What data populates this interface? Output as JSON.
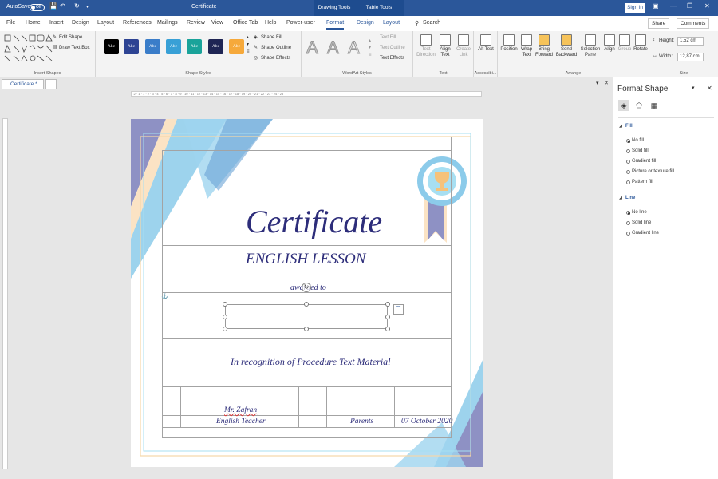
{
  "titlebar": {
    "autosave_label": "AutoSave",
    "autosave_state": "Off",
    "doc_title": "Certificate",
    "context_drawing": "Drawing Tools",
    "context_table": "Table Tools",
    "signin": "Sign in"
  },
  "tabs": [
    "File",
    "Home",
    "Insert",
    "Design",
    "Layout",
    "References",
    "Mailings",
    "Review",
    "View",
    "Office Tab",
    "Help",
    "Power-user",
    "Format",
    "Design",
    "Layout"
  ],
  "search_label": "Search",
  "share_label": "Share",
  "comments_label": "Comments",
  "ribbon": {
    "insert_shapes": {
      "label": "Insert Shapes",
      "edit_shape": "Edit Shape",
      "draw_text_box": "Draw Text Box"
    },
    "shape_styles": {
      "label": "Shape Styles",
      "style_text": "Abc",
      "colors": [
        "#000000",
        "#2d4393",
        "#3a7dc9",
        "#38a0d6",
        "#1aa39a",
        "#1f2554",
        "#f6a93b"
      ],
      "fill": "Shape Fill",
      "outline": "Shape Outline",
      "effects": "Shape Effects"
    },
    "wordart": {
      "label": "WordArt Styles",
      "glyph": "A",
      "text_fill": "Text Fill",
      "text_outline": "Text Outline",
      "text_effects": "Text Effects"
    },
    "text": {
      "label": "Text",
      "direction": "Text Direction",
      "align": "Align Text",
      "link": "Create Link"
    },
    "accessibility": {
      "label": "Accessibi...",
      "alt": "Alt Text"
    },
    "arrange": {
      "label": "Arrange",
      "position": "Position",
      "wrap": "Wrap Text",
      "forward": "Bring Forward",
      "backward": "Send Backward",
      "selection": "Selection Pane",
      "align": "Align",
      "group": "Group",
      "rotate": "Rotate"
    },
    "size": {
      "label": "Size",
      "height_label": "Height:",
      "height": "1,52 cm",
      "width_label": "Width:",
      "width": "12,87 cm"
    }
  },
  "doc_tab": "Certificate *",
  "ruler_text": "· 2 · 1 · 1 · 2 · 3 · 4 · 5 · 6 · 7 · 8 · 9 · 10 · 11 · 12 · 13 · 14 · 15 · 16 · 17 · 18 · 19 · 20 · 21 · 22 · 23 · 24 · 25",
  "certificate": {
    "title": "Certificate",
    "subtitle": "ENGLISH LESSON",
    "awarded": "awarded to",
    "recognition": "In recognition of Procedure Text Material",
    "teacher_name": "Mr. Zafran",
    "teacher_label": "English Teacher",
    "parents": "Parents",
    "date": "07 October 2020"
  },
  "format_pane": {
    "title": "Format Shape",
    "fill_section": "Fill",
    "fill_options": [
      "No fill",
      "Solid fill",
      "Gradient fill",
      "Picture or texture fill",
      "Pattern fill"
    ],
    "line_section": "Line",
    "line_options": [
      "No line",
      "Solid line",
      "Gradient line"
    ]
  }
}
